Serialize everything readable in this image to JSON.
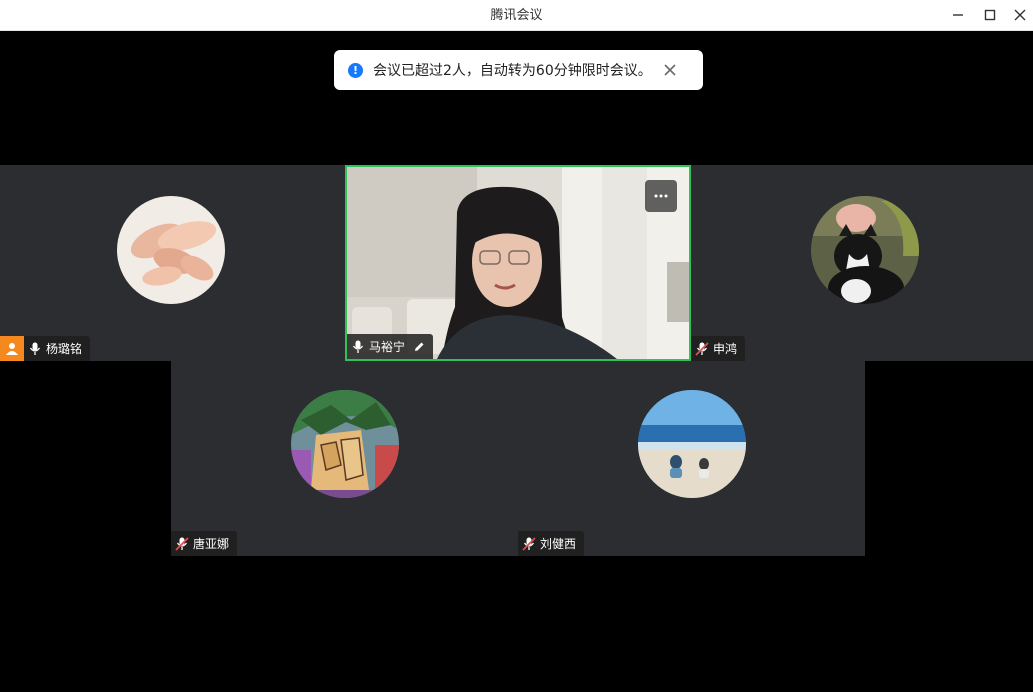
{
  "window": {
    "title": "腾讯会议"
  },
  "notification": {
    "text": "会议已超过2人，自动转为60分钟限时会议。",
    "icon": "info-icon",
    "accent": "#1677ff"
  },
  "participants": [
    {
      "name": "杨璐铭",
      "mic": "on",
      "is_host": true,
      "avatar": "hands-photo"
    },
    {
      "name": "马裕宁",
      "mic": "on",
      "video": true,
      "active_speaker": true,
      "avatar": "camera-feed"
    },
    {
      "name": "申鸿",
      "mic": "muted",
      "avatar": "cat-photo"
    },
    {
      "name": "唐亚娜",
      "mic": "muted",
      "avatar": "comic-art"
    },
    {
      "name": "刘健西",
      "mic": "muted",
      "avatar": "beach-photo"
    }
  ],
  "colors": {
    "active_border": "#2fc25b",
    "host_badge": "#f5891e",
    "muted_red": "#e34d4d",
    "tile_bg": "#2b2d30"
  }
}
